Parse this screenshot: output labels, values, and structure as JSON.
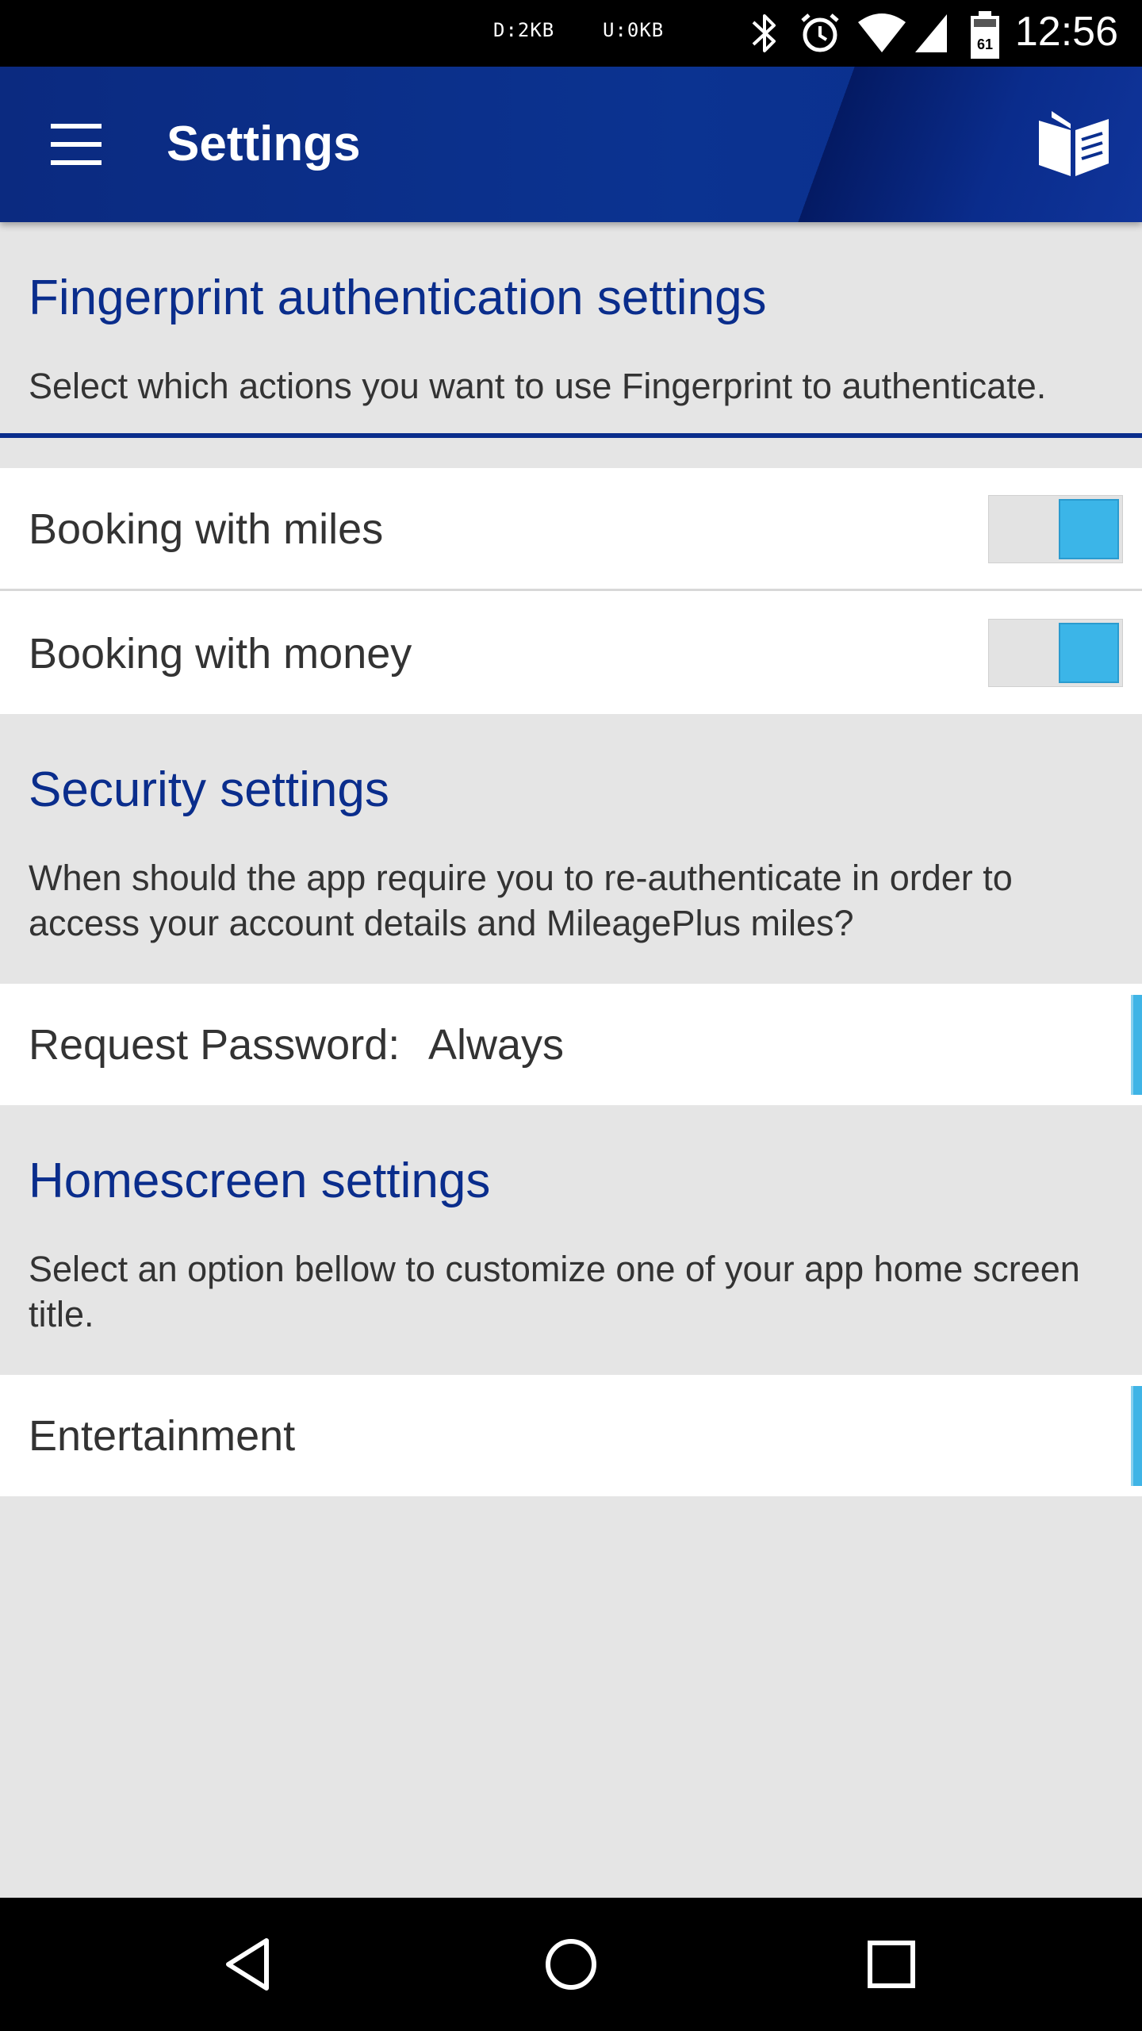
{
  "status_bar": {
    "download": "D:2KB",
    "upload": "U:0KB",
    "battery_level": "61",
    "time": "12:56",
    "icons": [
      "bluetooth-icon",
      "alarm-icon",
      "wifi-icon",
      "signal-icon",
      "battery-icon"
    ]
  },
  "app_bar": {
    "title": "Settings",
    "left_icon": "hamburger-menu-icon",
    "right_icon": "book-icon"
  },
  "fingerprint": {
    "title": "Fingerprint authentication settings",
    "description": "Select which actions you want to use Fingerprint to authenticate.",
    "items": [
      {
        "label": "Booking with miles",
        "enabled": true
      },
      {
        "label": "Booking with money",
        "enabled": true
      }
    ]
  },
  "security": {
    "title": "Security settings",
    "description": "When should the app require you to re-authenticate in order to access your account details and MileagePlus miles?",
    "request_password_label": "Request Password:",
    "request_password_value": "Always"
  },
  "homescreen": {
    "title": "Homescreen settings",
    "description": "Select an option bellow to customize one of your app home screen title.",
    "selected_option": "Entertainment"
  },
  "colors": {
    "brand_blue": "#0a2d8c",
    "toggle_on": "#3bb5e8",
    "background": "#e5e5e5"
  },
  "nav_bar": {
    "icons": [
      "back-icon",
      "home-icon",
      "recents-icon"
    ]
  }
}
